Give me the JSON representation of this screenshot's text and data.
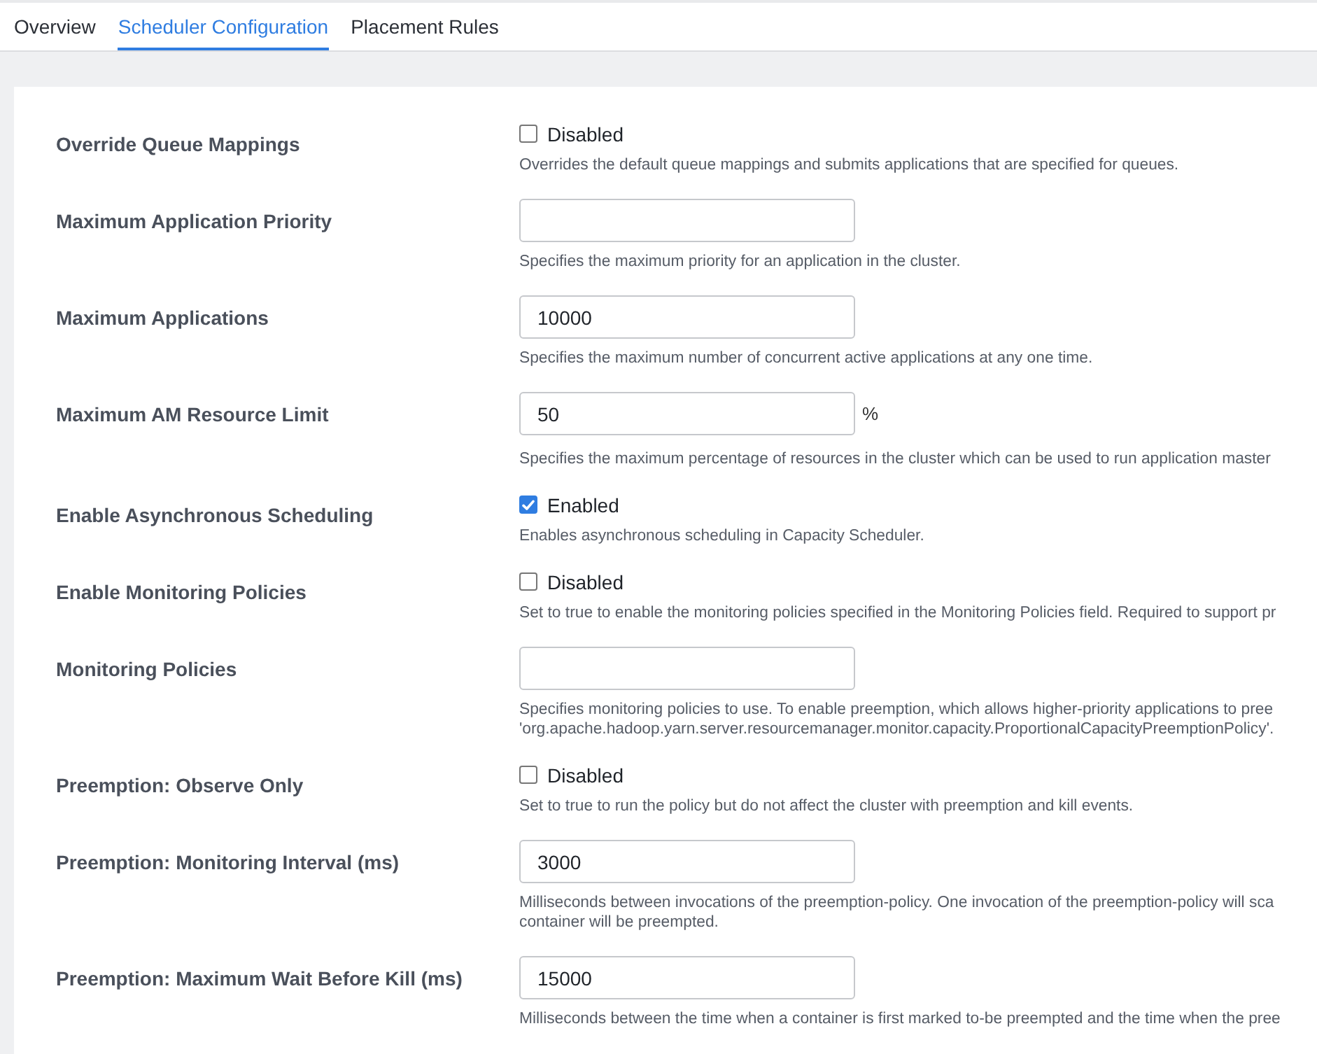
{
  "tabs": [
    {
      "label": "Overview",
      "selected": false
    },
    {
      "label": "Scheduler Configuration",
      "selected": true
    },
    {
      "label": "Placement Rules",
      "selected": false
    }
  ],
  "settings": [
    {
      "label": "Override Queue Mappings",
      "kind": "checkbox",
      "checked": false,
      "state_label": "Disabled",
      "description": [
        "Overrides the default queue mappings and submits applications that are specified for queues."
      ]
    },
    {
      "label": "Maximum Application Priority",
      "kind": "input",
      "description": [
        "Specifies the maximum priority for an application in the cluster."
      ]
    },
    {
      "label": "Maximum Applications",
      "kind": "input",
      "value": "10000",
      "description": [
        "Specifies the maximum number of concurrent active applications at any one time."
      ]
    },
    {
      "label": "Maximum AM Resource Limit",
      "kind": "input",
      "value": "50",
      "unit": "%",
      "description": [
        "Specifies the maximum percentage of resources in the cluster which can be used to run application master"
      ]
    },
    {
      "label": "Enable Asynchronous Scheduling",
      "kind": "checkbox",
      "checked": true,
      "state_label": "Enabled",
      "description": [
        "Enables asynchronous scheduling in Capacity Scheduler."
      ]
    },
    {
      "label": "Enable Monitoring Policies",
      "kind": "checkbox",
      "checked": false,
      "state_label": "Disabled",
      "description": [
        "Set to true to enable the monitoring policies specified in the Monitoring Policies field. Required to support pr"
      ]
    },
    {
      "label": "Monitoring Policies",
      "kind": "input",
      "description": [
        "Specifies monitoring policies to use. To enable preemption, which allows higher-priority applications to pree",
        "'org.apache.hadoop.yarn.server.resourcemanager.monitor.capacity.ProportionalCapacityPreemptionPolicy'."
      ]
    },
    {
      "label": "Preemption: Observe Only",
      "kind": "checkbox",
      "checked": false,
      "state_label": "Disabled",
      "description": [
        "Set to true to run the policy but do not affect the cluster with preemption and kill events."
      ]
    },
    {
      "label": "Preemption: Monitoring Interval (ms)",
      "kind": "input",
      "value": "3000",
      "description": [
        "Milliseconds between invocations of the preemption-policy. One invocation of the preemption-policy will sca",
        "container will be preempted."
      ]
    },
    {
      "label": "Preemption: Maximum Wait Before Kill (ms)",
      "kind": "input",
      "value": "15000",
      "description": [
        "Milliseconds between the time when a container is first marked to-be preempted and the time when the pree"
      ]
    }
  ]
}
